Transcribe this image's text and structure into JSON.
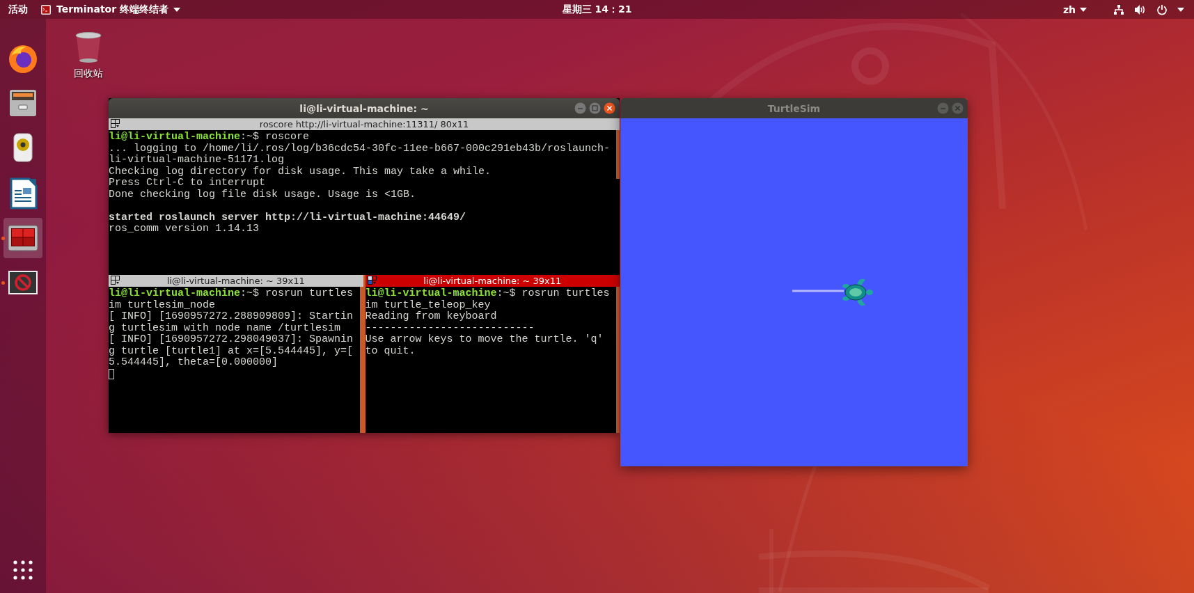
{
  "top_bar": {
    "activities": "活动",
    "app_menu": "Terminator 终端终结者",
    "clock": "星期三 14：21",
    "input_method": "zh"
  },
  "dock": {
    "items": [
      {
        "running": false,
        "selected": false
      },
      {
        "running": false,
        "selected": false
      },
      {
        "running": false,
        "selected": false
      },
      {
        "running": false,
        "selected": false
      },
      {
        "running": true,
        "selected": true
      },
      {
        "running": true,
        "selected": false
      }
    ]
  },
  "desktop_icons": [
    {
      "label": "回收站"
    }
  ],
  "terminal_window": {
    "title": "li@li-virtual-machine: ~",
    "top_pane": {
      "title": "roscore http://li-virtual-machine:11311/ 80x11",
      "selected": false,
      "lines": [
        {
          "kind": "prompt",
          "user": "li@li-virtual-machine",
          "text": ":~$ roscore"
        },
        {
          "kind": "text",
          "text": "... logging to /home/li/.ros/log/b36cdc54-30fc-11ee-b667-000c291eb43b/roslaunch-"
        },
        {
          "kind": "text",
          "text": "li-virtual-machine-51171.log"
        },
        {
          "kind": "text",
          "text": "Checking log directory for disk usage. This may take a while."
        },
        {
          "kind": "text",
          "text": "Press Ctrl-C to interrupt"
        },
        {
          "kind": "text",
          "text": "Done checking log file disk usage. Usage is <1GB."
        },
        {
          "kind": "blank"
        },
        {
          "kind": "bold",
          "text": "started roslaunch server http://li-virtual-machine:44649/"
        },
        {
          "kind": "text",
          "text": "ros_comm version 1.14.13"
        }
      ]
    },
    "bottom_panes": [
      {
        "title": "li@li-virtual-machine: ~ 39x11",
        "selected": false,
        "lines": [
          {
            "kind": "prompt",
            "user": "li@li-virtual-machine",
            "text": ":~$ rosrun turtles"
          },
          {
            "kind": "text",
            "text": "im turtlesim_node"
          },
          {
            "kind": "text",
            "text": "[ INFO] [1690957272.288909809]: Startin"
          },
          {
            "kind": "text",
            "text": "g turtlesim with node name /turtlesim"
          },
          {
            "kind": "text",
            "text": "[ INFO] [1690957272.298049037]: Spawnin"
          },
          {
            "kind": "text",
            "text": "g turtle [turtle1] at x=[5.544445], y=["
          },
          {
            "kind": "text",
            "text": "5.544445], theta=[0.000000]"
          },
          {
            "kind": "cursor"
          }
        ]
      },
      {
        "title": "li@li-virtual-machine: ~ 39x11",
        "selected": true,
        "lines": [
          {
            "kind": "prompt",
            "user": "li@li-virtual-machine",
            "text": ":~$ rosrun turtles"
          },
          {
            "kind": "text",
            "text": "im turtle_teleop_key"
          },
          {
            "kind": "text",
            "text": "Reading from keyboard"
          },
          {
            "kind": "text",
            "text": "---------------------------"
          },
          {
            "kind": "text",
            "text": "Use arrow keys to move the turtle. 'q'"
          },
          {
            "kind": "text",
            "text": "to quit."
          }
        ]
      }
    ]
  },
  "turtlesim_window": {
    "title": "TurtleSim"
  }
}
